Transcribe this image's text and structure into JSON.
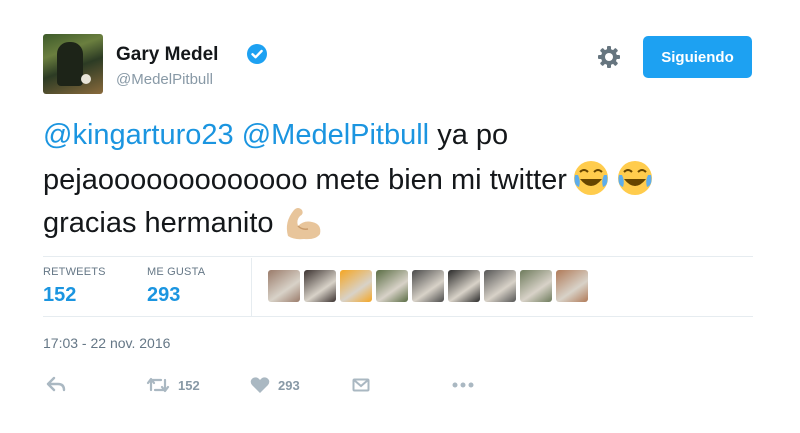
{
  "user": {
    "name": "Gary Medel",
    "handle": "@MedelPitbull"
  },
  "follow_button": {
    "label": "Siguiendo"
  },
  "tweet": {
    "mention1": "@kingarturo23",
    "mention2": "@MedelPitbull",
    "text_part1": " ya po pejaooooooooooooo mete bien mi twitter",
    "text_part2": "gracias hermanito"
  },
  "stats": {
    "retweets_label": "RETWEETS",
    "retweets_value": "152",
    "likes_label": "ME GUSTA",
    "likes_value": "293"
  },
  "liker_avatars": [
    {
      "color": "#9a7b6a"
    },
    {
      "color": "#3b3230"
    },
    {
      "color": "#f5a623"
    },
    {
      "color": "#5a6d44"
    },
    {
      "color": "#4a4a4a"
    },
    {
      "color": "#2a2a2a"
    },
    {
      "color": "#555555"
    },
    {
      "color": "#6e7b5c"
    },
    {
      "color": "#b07a58"
    }
  ],
  "timestamp": "17:03 - 22 nov. 2016",
  "actions": {
    "reply_icon": "reply-icon",
    "retweet_count": "152",
    "like_count": "293",
    "dm_icon": "direct-message-icon",
    "more_icon": "more-icon"
  },
  "colors": {
    "accent": "#1da1f2",
    "link": "#1b95e0"
  }
}
